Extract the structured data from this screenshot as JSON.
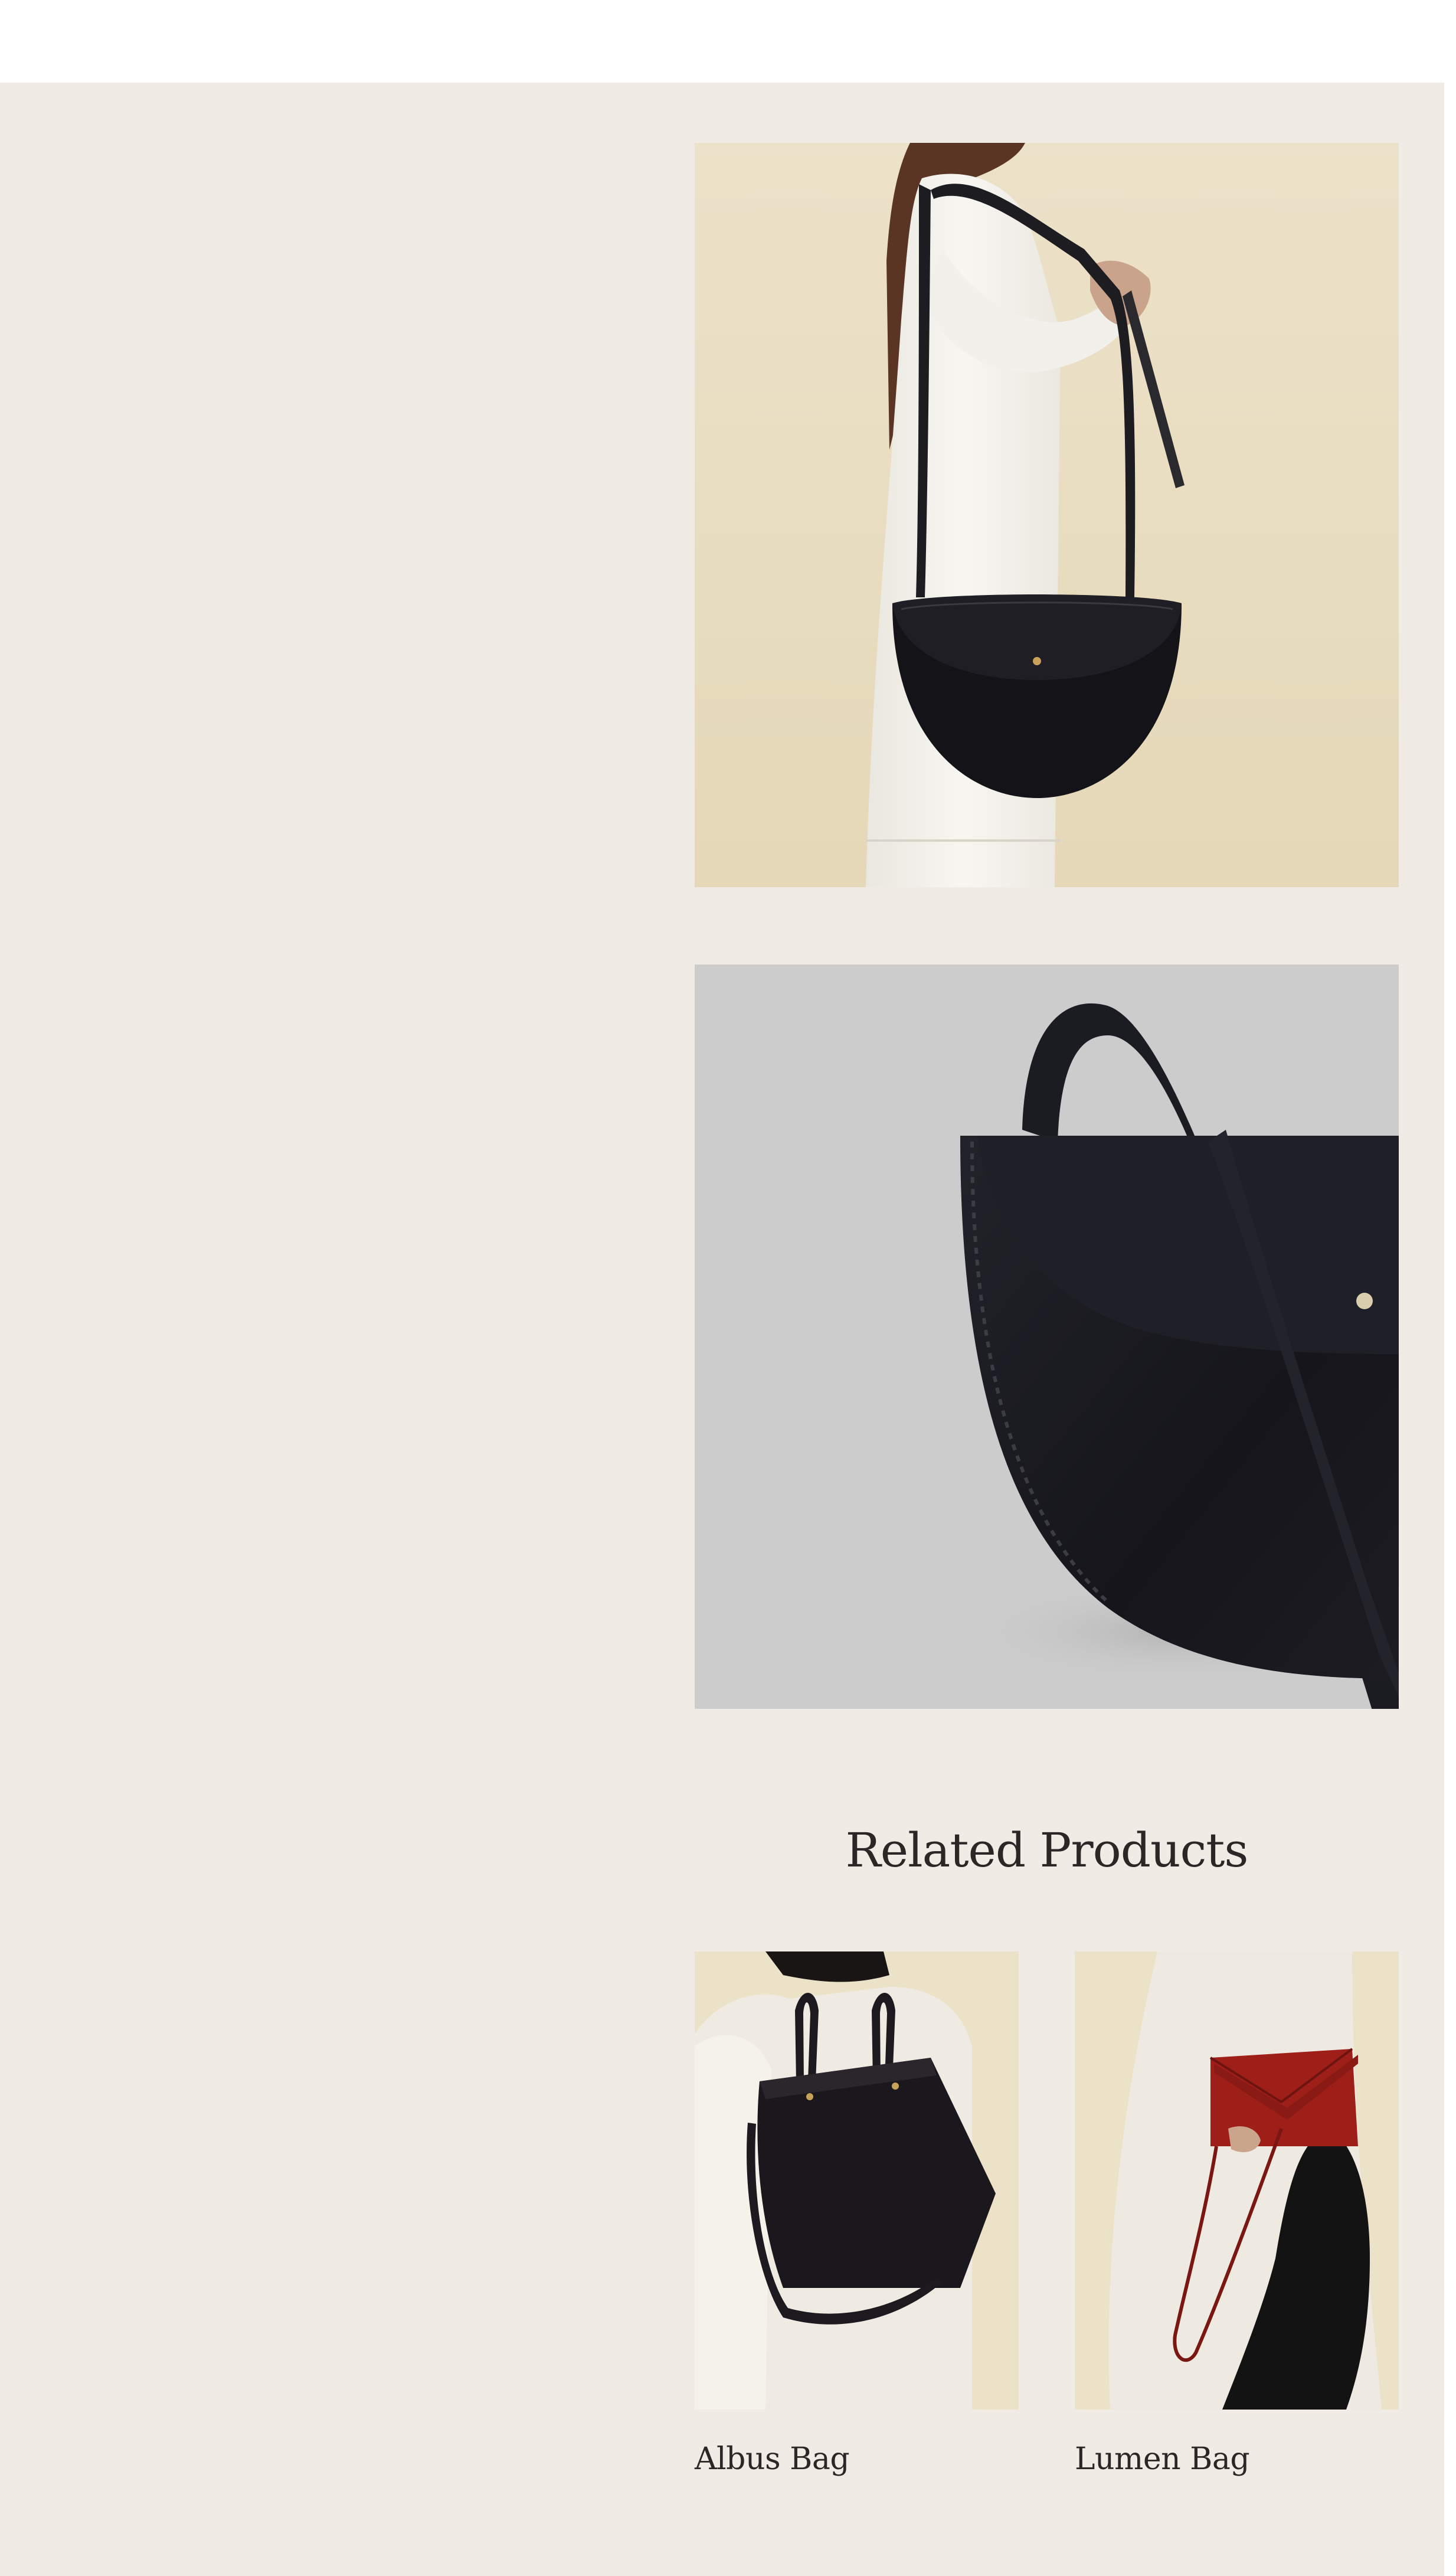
{
  "colors": {
    "page_background": "#f0ebe5",
    "top_bar": "#ffffff",
    "text": "#2b2727"
  },
  "gallery": {
    "images": [
      {
        "name": "product-photo-model",
        "subject": "half-moon black leather shoulder bag worn by model in white coat"
      },
      {
        "name": "product-photo-detail",
        "subject": "close-up of black half-moon leather bag on grey background"
      }
    ]
  },
  "related": {
    "title": "Related Products",
    "products": [
      {
        "name": "Albus Bag",
        "icon": "black-leather-tote-photo"
      },
      {
        "name": "Lumen Bag",
        "icon": "red-leather-envelope-bag-photo"
      }
    ]
  }
}
